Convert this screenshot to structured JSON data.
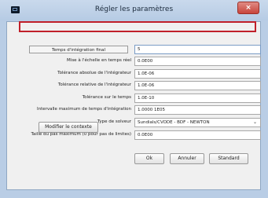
{
  "window": {
    "title": "Régler les paramètres",
    "close_label": "×"
  },
  "form": {
    "fields": [
      {
        "label": "Temps d'intégration final",
        "value": "5"
      },
      {
        "label": "Mise à l'échelle en temps réel",
        "value": "0.0E00"
      },
      {
        "label": "Tolérance absolue de l'intégrateur",
        "value": "1.0E-06"
      },
      {
        "label": "Tolérance relative de l'intégrateur",
        "value": "1.0E-06"
      },
      {
        "label": "Tolérance sur le temps",
        "value": "1.0E-10"
      },
      {
        "label": "Intervalle maximum de temps d'intégration",
        "value": "1.0000 1E05"
      }
    ],
    "solver": {
      "label": "Type de solveur",
      "value": "Sundials/CVODE - BDF - NEWTON"
    },
    "max_step": {
      "label": "Taille du pas maximum (0 pour pas de limites)",
      "value": "0.0E00"
    }
  },
  "buttons": {
    "modify_context": "Modifier le contexte",
    "ok": "Ok",
    "cancel": "Annuler",
    "standard": "Standard"
  }
}
